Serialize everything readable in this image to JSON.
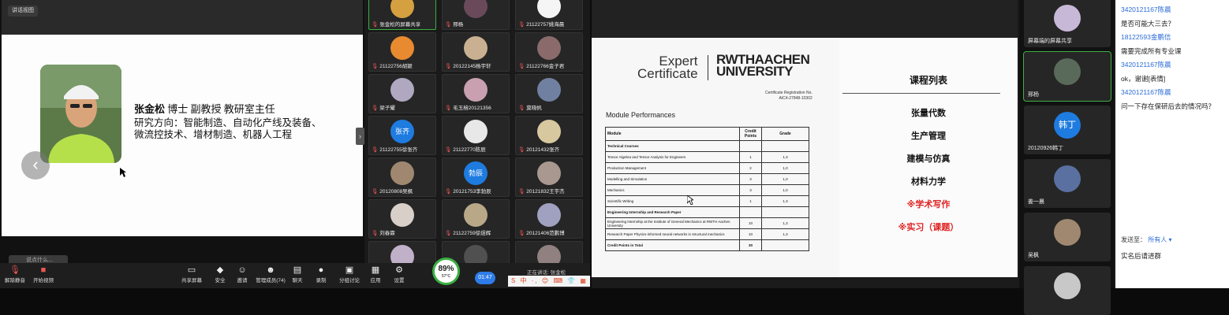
{
  "left": {
    "recording_badge": "讲话视图",
    "professor": {
      "name": "张金松",
      "title_rest": " 博士 副教授 教研室主任",
      "line1": "研究方向：智能制造、自动化产线及装备、",
      "line2": "微流控技术、增材制造、机器人工程"
    },
    "chat_pill": "说点什么...",
    "tiles": [
      {
        "label": "张金松的屏幕共享",
        "avatar_color": "#d4a040"
      },
      {
        "label": "邢杨",
        "avatar_color": "#6a4a5a"
      },
      {
        "label": "21122757姚海晨",
        "avatar_color": "#f5f5f5"
      },
      {
        "label": "21122756胡颖",
        "avatar_color": "#e88a30"
      },
      {
        "label": "20122145杨宇轩",
        "avatar_color": "#c8b090"
      },
      {
        "label": "21122766金子君",
        "avatar_color": "#8a6a6a"
      },
      {
        "label": "梁子耀",
        "avatar_color": "#b0a8c0"
      },
      {
        "label": "毛玉榕20121356",
        "avatar_color": "#c8a0b0"
      },
      {
        "label": "莫晓帆",
        "avatar_color": "#7080a0"
      },
      {
        "label": "21122755徐张齐",
        "avatar_color": "#1e7be0",
        "avatar_text": "张齐"
      },
      {
        "label": "21122770陈辰",
        "avatar_color": "#e8e8e8"
      },
      {
        "label": "20121432张齐",
        "avatar_color": "#d8c8a0"
      },
      {
        "label": "20120808吴枫",
        "avatar_color": "#a08870"
      },
      {
        "label": "20121753李勃辰",
        "avatar_color": "#1e7be0",
        "avatar_text": "勃辰"
      },
      {
        "label": "20121832王宇杰",
        "avatar_color": "#a89890"
      },
      {
        "label": "刘春霖",
        "avatar_color": "#d8d0c8"
      },
      {
        "label": "21122759徐煜辉",
        "avatar_color": "#b8a888"
      },
      {
        "label": "20121406范鹏博",
        "avatar_color": "#a0a0c0"
      },
      {
        "label": "",
        "avatar_color": "#c0b0c8"
      },
      {
        "label": "",
        "avatar_color": "#505050"
      },
      {
        "label": "",
        "avatar_color": "#908080"
      }
    ],
    "toolbar": {
      "unmute": "解除静音",
      "start_video": "开始视频",
      "share": "共享屏幕",
      "security": "安全",
      "invite": "邀请",
      "members": "管理成员(74)",
      "chat": "聊天",
      "record": "录制",
      "breakout": "分组讨论",
      "apps": "应用",
      "settings": "设置"
    },
    "cpu_percent": "89%",
    "cpu_temp": "57°C",
    "clock": "01:47",
    "talking": "正在讲话: 张金松",
    "ime": "S 中 ·, 😊 ⌨ 👕 ▦"
  },
  "right": {
    "logo": {
      "expert": "Expert",
      "certificate": "Certificate",
      "rwth1": "RWTHAACHEN",
      "rwth2": "UNIVERSITY"
    },
    "cert_reg": "Certificate Registration No.",
    "cert_no": "AIC4-27848-10302",
    "module_performances": "Module Performances",
    "table": {
      "headers": [
        "Module",
        "Credit Points",
        "Grade"
      ],
      "rows": [
        {
          "module": "Technical Courses",
          "credits": "",
          "grade": "",
          "section": true
        },
        {
          "module": "Tensor Algebra and Tensor Analysis for Engineers",
          "credits": "1",
          "grade": "1,3"
        },
        {
          "module": "Production Management",
          "credits": "2",
          "grade": "1,0"
        },
        {
          "module": "Modelling and Simulation",
          "credits": "3",
          "grade": "1,0"
        },
        {
          "module": "Mechanics",
          "credits": "3",
          "grade": "1,0"
        },
        {
          "module": "Scientific Writing",
          "credits": "1",
          "grade": "1,3"
        },
        {
          "module": "Engineering Internship and Research Paper",
          "credits": "",
          "grade": "",
          "section": true
        },
        {
          "module": "Engineering Internship at the Institute of General Mechanics at RWTH Aachen University",
          "credits": "10",
          "grade": "1,3"
        },
        {
          "module": "Research Paper Physics-informed neural networks in structural mechanics",
          "credits": "10",
          "grade": "1,3"
        },
        {
          "module": "Credit Points in Total",
          "credits": "30",
          "grade": "",
          "section": true
        }
      ]
    },
    "course_list_title": "课程列表",
    "courses": [
      {
        "name": "张量代数",
        "red": false
      },
      {
        "name": "生产管理",
        "red": false
      },
      {
        "name": "建模与仿真",
        "red": false
      },
      {
        "name": "材料力学",
        "red": false
      },
      {
        "name": "※学术写作",
        "red": true
      },
      {
        "name": "※实习（课题）",
        "red": true
      }
    ],
    "tiles": [
      {
        "label": "屏幕端的屏幕共享",
        "avatar_color": "#c8b8d8"
      },
      {
        "label": "邢杨",
        "avatar_color": "#5a6a5a"
      },
      {
        "label": "20120926韩丁",
        "avatar_color": "#1e7be0",
        "avatar_text": "韩丁"
      },
      {
        "label": "姜一晨",
        "avatar_color": "#5a70a0"
      },
      {
        "label": "吴枫",
        "avatar_color": "#a08870"
      },
      {
        "label": "",
        "avatar_color": "#c8c8c8"
      }
    ],
    "chat": [
      {
        "type": "user",
        "text": "3420121167陈晨"
      },
      {
        "type": "msg",
        "text": "是否可能大三去？"
      },
      {
        "type": "user",
        "text": "18122593金鹏信"
      },
      {
        "type": "msg",
        "text": "需要完成所有专业课"
      },
      {
        "type": "user",
        "text": "3420121167陈晨"
      },
      {
        "type": "msg",
        "text": "ok，谢谢[表情]"
      },
      {
        "type": "user",
        "text": "3420121167陈晨"
      },
      {
        "type": "msg",
        "text": "问一下存在保研后去的情况吗？"
      }
    ],
    "send_to_label": "发送至：",
    "send_to_value": "所有人 ▾",
    "chat_input": "实名后请进群"
  }
}
